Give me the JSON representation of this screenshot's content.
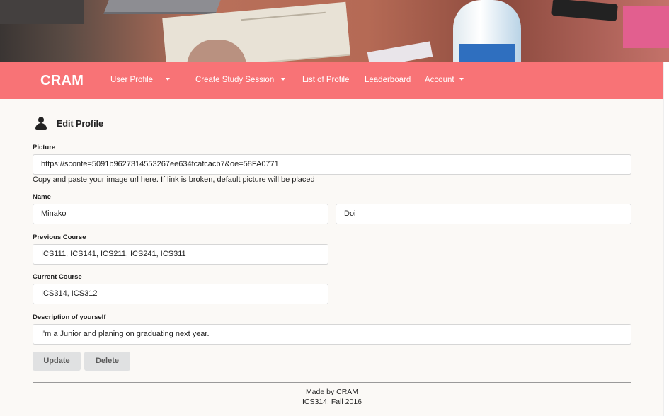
{
  "nav": {
    "brand": "CRAM",
    "items": [
      {
        "label": "User Profile",
        "dropdown": true
      },
      {
        "label": "Create Study Session",
        "dropdown": true
      },
      {
        "label": "List of Profile",
        "dropdown": false
      },
      {
        "label": "Leaderboard",
        "dropdown": false
      },
      {
        "label": "Account",
        "dropdown": true
      }
    ]
  },
  "section": {
    "icon": "user-icon",
    "title": "Edit Profile"
  },
  "form": {
    "picture_label": "Picture",
    "picture_value": "https://sconte=5091b9627314553267ee634fcafcacb7&oe=58FA0771",
    "picture_help": "Copy and paste your image url here. If link is broken, default picture will be placed",
    "name_label": "Name",
    "first_name": "Minako",
    "last_name": "Doi",
    "previous_label": "Previous Course",
    "previous_value": "ICS111, ICS141, ICS211, ICS241, ICS311",
    "current_label": "Current Course",
    "current_value": "ICS314, ICS312",
    "description_label": "Description of yourself",
    "description_value": "I'm a Junior and planing on graduating next year."
  },
  "buttons": {
    "update": "Update",
    "delete": "Delete"
  },
  "footer": {
    "line1": "Made by CRAM",
    "line2": "ICS314, Fall 2016"
  },
  "colors": {
    "navbar": "#f87376",
    "background": "#fbf9f6",
    "button": "#e0e1e2"
  }
}
